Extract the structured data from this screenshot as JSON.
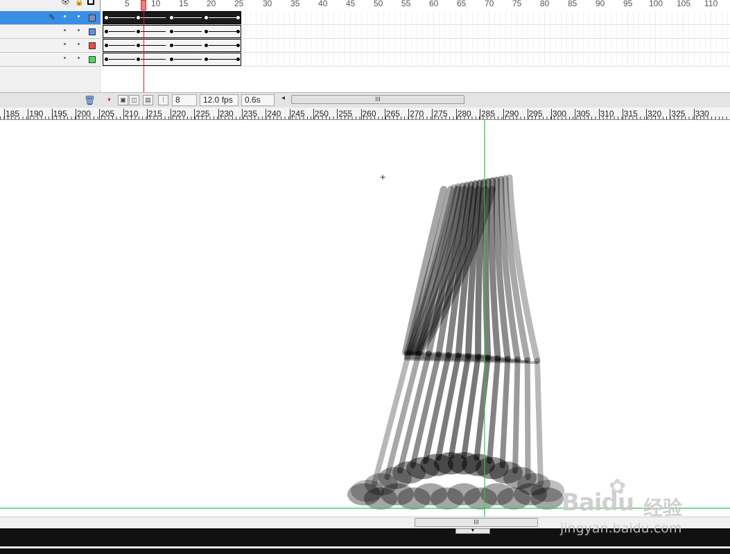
{
  "timeline": {
    "header_icons": [
      "eye-icon",
      "lock-icon",
      "outline-icon"
    ],
    "layers": [
      {
        "name": "",
        "selected": true,
        "color": "#7a8fbf"
      },
      {
        "name": "",
        "selected": false,
        "color": "#5b8ef0"
      },
      {
        "name": "",
        "selected": false,
        "color": "#f04848"
      },
      {
        "name": "",
        "selected": false,
        "color": "#44dd55"
      }
    ],
    "frame_ruler": [
      "5",
      "10",
      "15",
      "20",
      "25",
      "30",
      "35",
      "40",
      "45",
      "50",
      "55",
      "60",
      "65",
      "70",
      "75",
      "80",
      "85",
      "90",
      "95",
      "100",
      "105",
      "110"
    ],
    "current_frame": "8",
    "fps": "12.0 fps",
    "elapsed": "0.6s",
    "scroll_grip": "III"
  },
  "stage": {
    "ruler_labels": [
      "185",
      "190",
      "195",
      "200",
      "205",
      "210",
      "215",
      "220",
      "225",
      "230",
      "235",
      "240",
      "245",
      "250",
      "255",
      "260",
      "265",
      "270",
      "275",
      "280",
      "285",
      "290",
      "295",
      "300",
      "305",
      "310",
      "315",
      "320",
      "325",
      "330"
    ],
    "scroll_grip": "III",
    "guide_color": "#22cc44"
  },
  "watermark": {
    "logo": "Bai",
    "logo_du": "du",
    "cn": "经验",
    "url": "jingyan.baidu.com"
  }
}
